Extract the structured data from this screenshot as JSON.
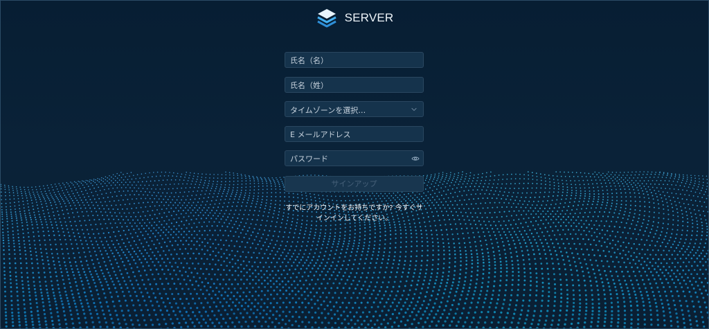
{
  "brand": {
    "name": "SERVER",
    "logo_icon": "stack-layers-icon"
  },
  "form": {
    "first_name_placeholder": "氏名（名）",
    "last_name_placeholder": "氏名（姓）",
    "timezone_placeholder": "タイムゾーンを選択…",
    "email_placeholder": "E メールアドレス",
    "password_placeholder": "パスワード",
    "signup_label": "サインアップ"
  },
  "signin_prompt": "すでにアカウントをお持ちですか? 今すぐサインインしてください。",
  "colors": {
    "background": "#071e33",
    "field_background": "#15334c",
    "field_border": "#2a4760",
    "accent": "#2f9fe6"
  }
}
